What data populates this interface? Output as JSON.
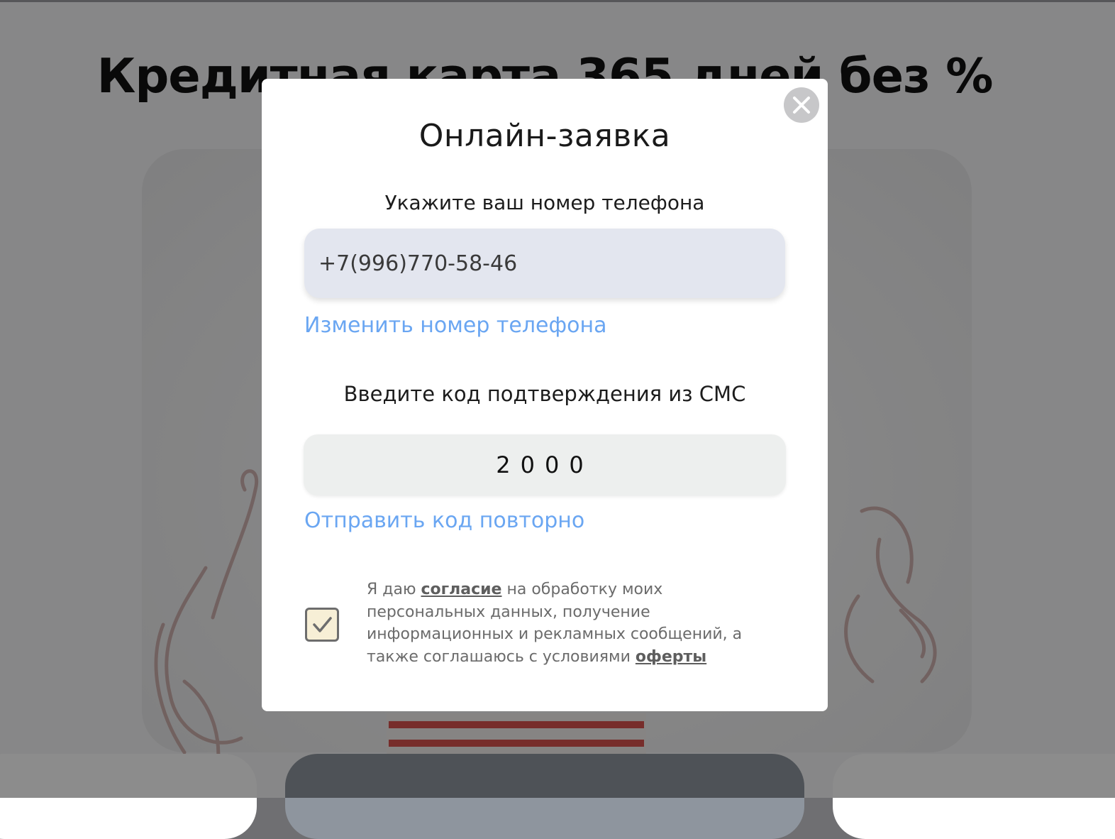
{
  "background": {
    "title": "Кредитная карта 365 дней без %"
  },
  "modal": {
    "title": "Онлайн-заявка",
    "phone_label": "Укажите ваш номер телефона",
    "phone_value": "+7(996)770-58-46",
    "change_phone_link": "Изменить номер телефона",
    "code_label": "Введите код подтверждения из СМС",
    "code_value": "2000",
    "resend_link": "Отправить код повторно",
    "consent": {
      "checked": true,
      "text_1": "Я даю ",
      "link_1": "согласие",
      "text_2": " на обработку моих персональных данных, получение информационных и рекламных сообщений, а также соглашаюсь с условиями ",
      "link_2": "оферты"
    },
    "close_icon": "close-icon",
    "check_icon": "checkmark-icon"
  },
  "colors": {
    "link": "#6aa6f2",
    "overlay": "rgba(0,0,0,0.45)",
    "phone_input_bg": "#e3e6ef",
    "code_input_bg": "#edefee",
    "checkbox_bg": "#f7efd6"
  }
}
